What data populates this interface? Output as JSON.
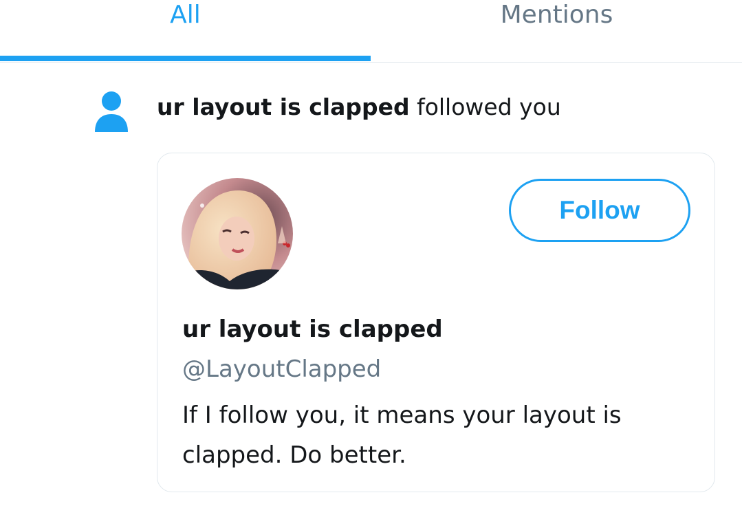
{
  "tabs": {
    "all_label": "All",
    "mentions_label": "Mentions",
    "active": "All"
  },
  "notification": {
    "actor_name": "ur layout is clapped",
    "action_text": " followed you",
    "icon": "person-icon"
  },
  "profile_card": {
    "display_name": "ur layout is clapped",
    "handle": "@LayoutClapped",
    "bio": "If I follow you, it means your layout is clapped. Do better.",
    "follow_label": "Follow",
    "avatar": "profile-photo"
  },
  "colors": {
    "accent": "#1da1f2",
    "secondary_text": "#657786",
    "border": "#e1e8ed"
  }
}
